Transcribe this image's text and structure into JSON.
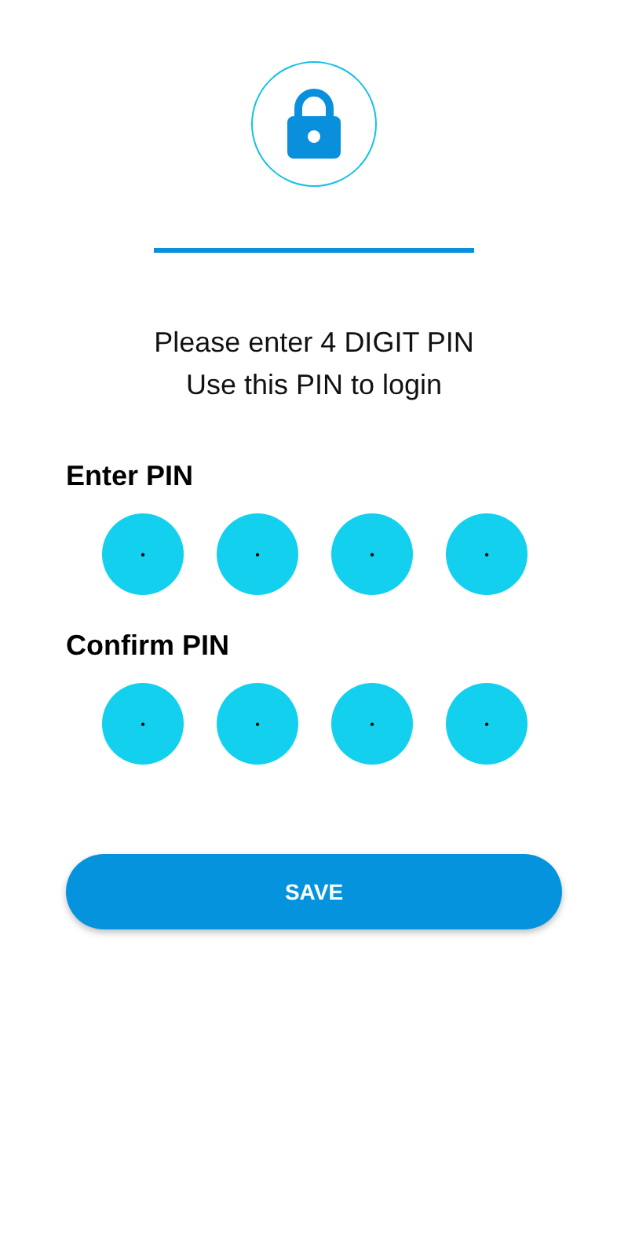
{
  "instructions": [
    "Please enter 4 DIGIT PIN",
    "Use this PIN to login"
  ],
  "pin_groups": [
    {
      "label": "Enter PIN",
      "fields": [
        {
          "placeholder": "•"
        },
        {
          "placeholder": "•"
        },
        {
          "placeholder": "•"
        },
        {
          "placeholder": "•"
        }
      ]
    },
    {
      "label": "Confirm PIN",
      "fields": [
        {
          "placeholder": "•"
        },
        {
          "placeholder": "•"
        },
        {
          "placeholder": "•"
        },
        {
          "placeholder": "•"
        }
      ]
    }
  ],
  "save_button": {
    "label": "SAVE"
  }
}
